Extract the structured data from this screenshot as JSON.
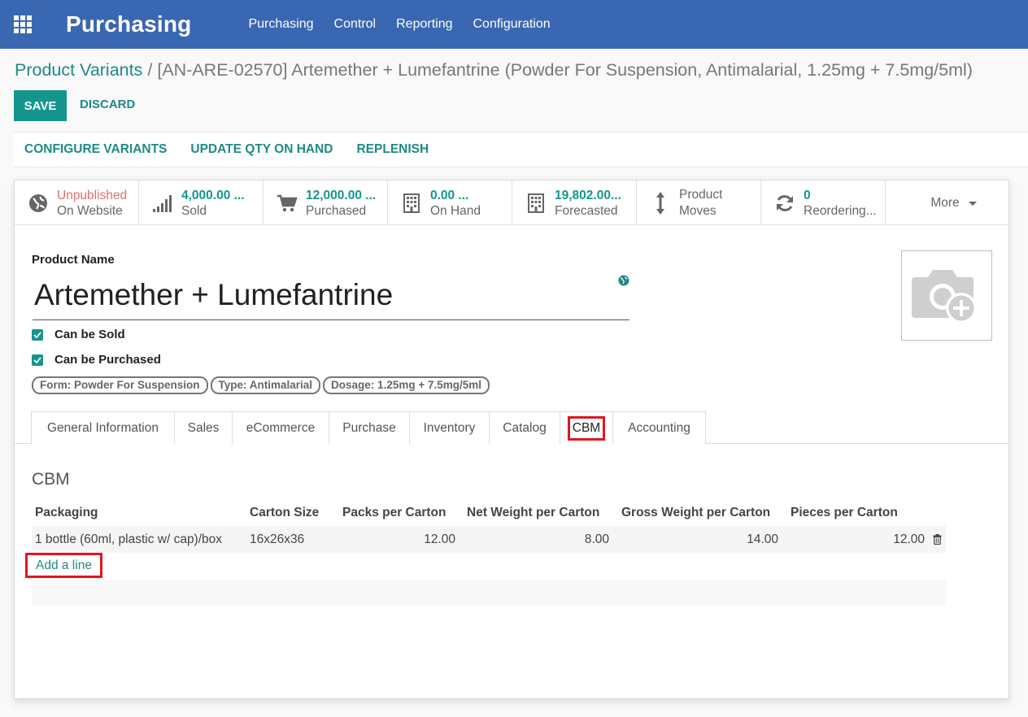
{
  "navbar": {
    "brand": "Purchasing",
    "menu": [
      "Purchasing",
      "Control",
      "Reporting",
      "Configuration"
    ]
  },
  "breadcrumb": {
    "parent": "Product Variants",
    "separator": "/",
    "current": "[AN-ARE-02570] Artemether + Lumefantrine (Powder For Suspension, Antimalarial, 1.25mg + 7.5mg/5ml)"
  },
  "actions": {
    "save": "SAVE",
    "discard": "DISCARD"
  },
  "statusbar": [
    "CONFIGURE VARIANTS",
    "UPDATE QTY ON HAND",
    "REPLENISH"
  ],
  "smart_buttons": [
    {
      "value": "Unpublished",
      "label": "On Website",
      "icon": "globe-icon"
    },
    {
      "value": "4,000.00 ...",
      "label": "Sold",
      "icon": "signal-icon"
    },
    {
      "value": "12,000.00 ...",
      "label": "Purchased",
      "icon": "cart-icon"
    },
    {
      "value": "0.00 ...",
      "label": "On Hand",
      "icon": "building-icon"
    },
    {
      "value": "19,802.00...",
      "label": "Forecasted",
      "icon": "building-icon"
    },
    {
      "line1": "Product",
      "line2": "Moves",
      "icon": "arrows-v-icon"
    },
    {
      "value": "0",
      "label": "Reordering...",
      "icon": "refresh-icon"
    },
    {
      "label": "More"
    }
  ],
  "form": {
    "product_name_label": "Product Name",
    "product_name": "Artemether + Lumefantrine",
    "can_be_sold": "Can be Sold",
    "can_be_purchased": "Can be Purchased",
    "tags": [
      "Form: Powder For Suspension",
      "Type: Antimalarial",
      "Dosage: 1.25mg + 7.5mg/5ml"
    ]
  },
  "tabs": [
    "General Information",
    "Sales",
    "eCommerce",
    "Purchase",
    "Inventory",
    "Catalog",
    "CBM",
    "Accounting"
  ],
  "active_tab": "CBM",
  "cbm": {
    "title": "CBM",
    "columns": [
      "Packaging",
      "Carton Size",
      "Packs per Carton",
      "Net Weight per Carton",
      "Gross Weight per Carton",
      "Pieces per Carton"
    ],
    "rows": [
      {
        "packaging": "1 bottle (60ml, plastic w/ cap)/box",
        "carton_size": "16x26x36",
        "packs": "12.00",
        "net_weight": "8.00",
        "gross_weight": "14.00",
        "pieces": "12.00"
      }
    ],
    "add_line": "Add a line"
  },
  "colors": {
    "navbar": "#3a67b1",
    "primary": "#14968f",
    "link": "#1f8a84",
    "highlight": "#e0161f",
    "unpublished": "#e0706d"
  }
}
